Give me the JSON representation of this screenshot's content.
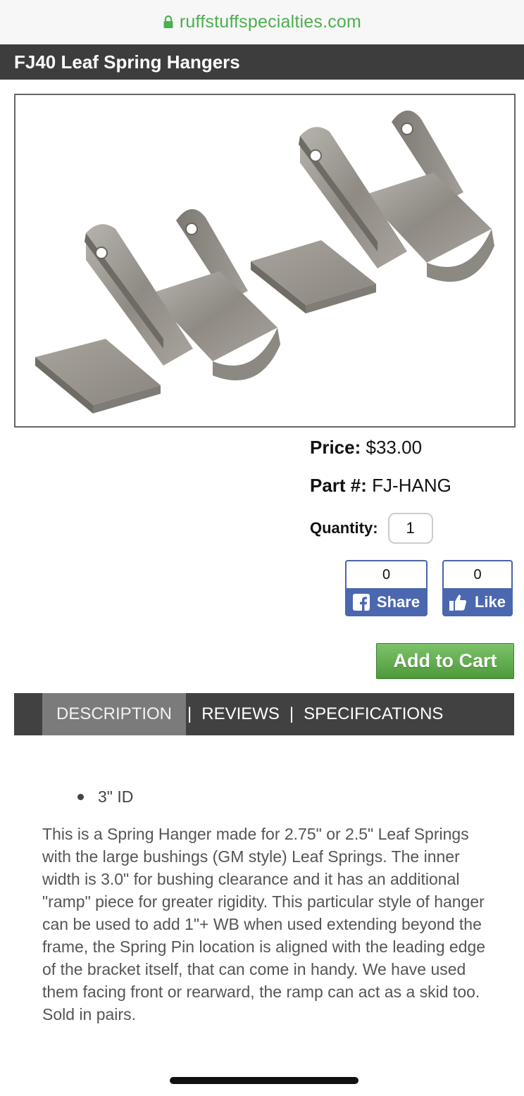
{
  "browser": {
    "url": "ruffstuffspecialties.com"
  },
  "page": {
    "title": "FJ40 Leaf Spring Hangers"
  },
  "product": {
    "price_label": "Price:",
    "price_value": "$33.00",
    "part_label": "Part #:",
    "part_value": "FJ-HANG",
    "quantity_label": "Quantity:",
    "quantity_value": "1"
  },
  "social": {
    "share_count": "0",
    "share_label": "Share",
    "like_count": "0",
    "like_label": "Like"
  },
  "cart": {
    "add_label": "Add to Cart"
  },
  "tabs": [
    {
      "label": "DESCRIPTION"
    },
    {
      "label": "REVIEWS"
    },
    {
      "label": "SPECIFICATIONS"
    }
  ],
  "tab_separator": "|",
  "description": {
    "bullet": "3\" ID",
    "body": "This is a Spring Hanger made for 2.75\" or 2.5\" Leaf Springs with the large bushings (GM style) Leaf Springs. The inner width is 3.0\" for bushing clearance and it has an additional \"ramp\" piece for greater rigidity. This particular style of hanger can be used to add 1\"+ WB when used extending beyond the frame, the Spring Pin location is aligned with the leading edge of the bracket itself, that can come in handy. We have used them facing front or rearward, the ramp can act as a skid too. Sold in pairs."
  },
  "colors": {
    "url_green": "#4caf50",
    "title_bar": "#3d3d3d",
    "facebook_blue": "#4a67b0",
    "cart_green": "#5fae4a",
    "tab_bar": "#414141",
    "tab_active": "#7b7b7b"
  },
  "icons": [
    "lock-icon",
    "facebook-icon",
    "thumbs-up-icon"
  ]
}
